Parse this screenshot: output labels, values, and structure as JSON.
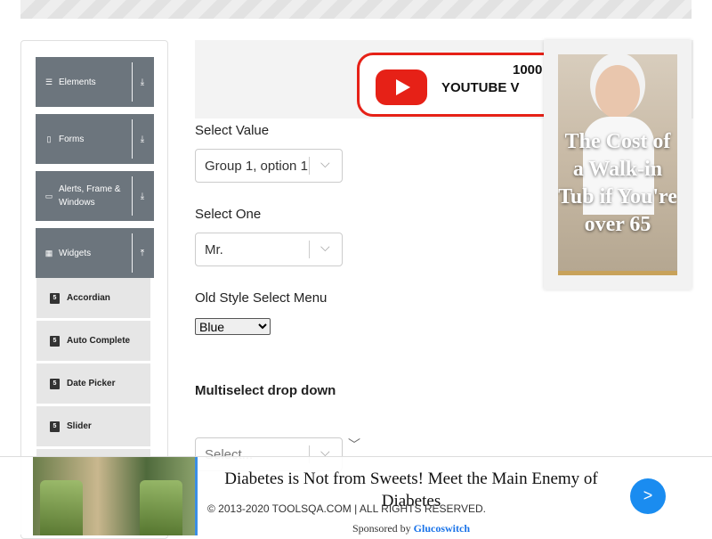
{
  "sidebar": {
    "groups": [
      {
        "label": "Elements",
        "icon": "hamburger-icon",
        "arrow": "⤓"
      },
      {
        "label": "Forms",
        "icon": "form-icon",
        "arrow": "⤓"
      },
      {
        "label": "Alerts, Frame & Windows",
        "icon": "window-icon",
        "arrow": "⤓"
      },
      {
        "label": "Widgets",
        "icon": "grid-icon",
        "arrow": "⤒"
      }
    ],
    "widgets": [
      {
        "label": "Accordian"
      },
      {
        "label": "Auto Complete"
      },
      {
        "label": "Date Picker"
      },
      {
        "label": "Slider"
      }
    ]
  },
  "top_ad": {
    "line1": "1000",
    "line2": "YOUTUBE V"
  },
  "main": {
    "select_value_label": "Select Value",
    "select_value": "Group 1, option 1",
    "select_one_label": "Select One",
    "select_one": "Mr.",
    "old_select_label": "Old Style Select Menu",
    "old_select_value": "Blue",
    "multiselect_label": "Multiselect drop down",
    "multiselect_placeholder": "Select..."
  },
  "side_ad": {
    "text": "The Cost of a Walk-in Tub if You're over 65"
  },
  "bottom_ad": {
    "title": "Diabetes is Not from Sweets! Meet the Main Enemy of Diabetes",
    "copyright": "© 2013-2020 TOOLSQA.COM | ALL RIGHTS RESERVED.",
    "sponsor_prefix": "Sponsored by",
    "sponsor_name": "Glucoswitch",
    "next": ">"
  }
}
